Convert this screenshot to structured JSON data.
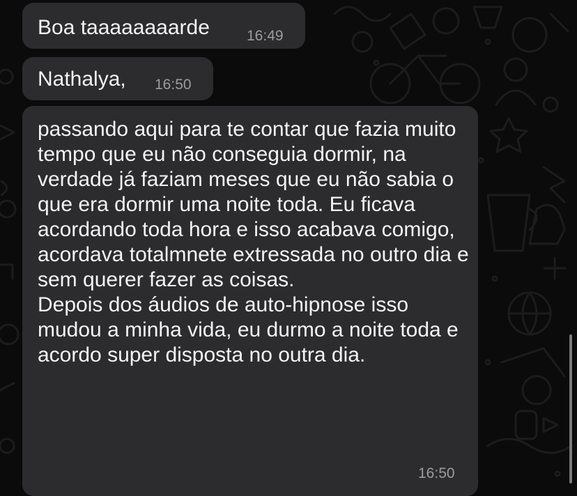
{
  "messages": [
    {
      "text": "Boa taaaaaaaarde",
      "time": "16:49"
    },
    {
      "text": "Nathalya,",
      "time": "16:50"
    },
    {
      "text": "passando aqui para te contar que fazia muito tempo que eu não conseguia dormir, na verdade já faziam meses que eu não sabia o que era dormir uma noite toda. Eu ficava acordando toda hora e isso acabava comigo, acordava totalmnete extressada no outro dia e sem querer fazer as coisas.\nDepois dos áudios de auto-hipnose isso mudou a minha vida, eu durmo a noite toda e acordo super disposta no outra dia.",
      "time": "16:50"
    }
  ],
  "colors": {
    "background": "#0b0b0b",
    "bubble": "#2c2c2e",
    "text": "#f4f4f4",
    "timestamp": "#9c9c9e"
  }
}
